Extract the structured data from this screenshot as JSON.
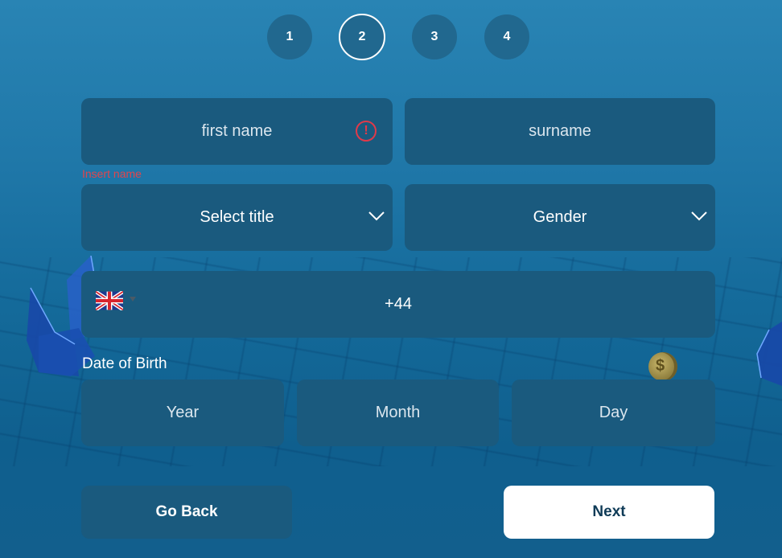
{
  "stepper": {
    "steps": [
      {
        "label": "1",
        "active": false
      },
      {
        "label": "2",
        "active": true
      },
      {
        "label": "3",
        "active": false
      },
      {
        "label": "4",
        "active": false
      }
    ]
  },
  "form": {
    "first_name": {
      "placeholder": "first name",
      "value": "",
      "error": "Insert name"
    },
    "surname": {
      "placeholder": "surname",
      "value": ""
    },
    "title_select": {
      "selected": "Select title"
    },
    "gender_select": {
      "selected": "Gender"
    },
    "phone": {
      "country": "GB",
      "country_icon": "uk-flag-icon",
      "dial_code": "+44"
    },
    "dob": {
      "label": "Date of Birth",
      "year": {
        "placeholder": "Year"
      },
      "month": {
        "placeholder": "Month"
      },
      "day": {
        "placeholder": "Day"
      }
    }
  },
  "actions": {
    "back_label": "Go Back",
    "next_label": "Next"
  },
  "colors": {
    "background": "#1f77a8",
    "field_bg": "#1a5a7e",
    "error": "#e03a4a",
    "next_bg": "#ffffff",
    "next_text": "#0f3b57"
  }
}
